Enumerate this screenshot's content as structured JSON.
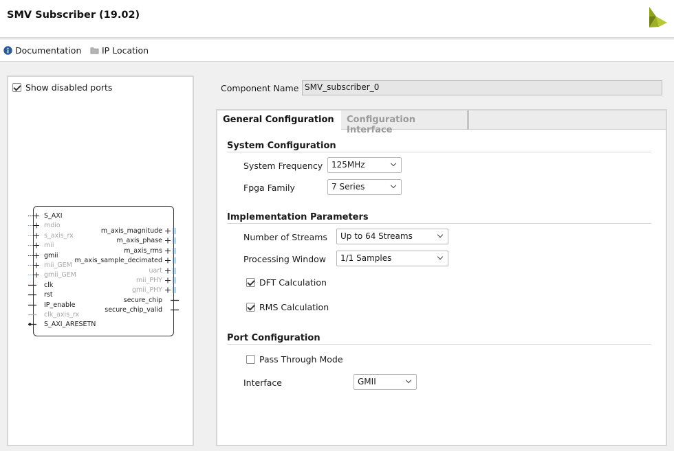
{
  "window": {
    "title": "SMV Subscriber (19.02)"
  },
  "toolbar": {
    "documentation": "Documentation",
    "ip_location": "IP Location"
  },
  "left_panel": {
    "show_disabled_ports": "Show disabled ports",
    "block": {
      "left_ports": [
        {
          "name": "S_AXI",
          "disabled": false
        },
        {
          "name": "mdio",
          "disabled": true
        },
        {
          "name": "s_axis_rx",
          "disabled": true
        },
        {
          "name": "mii",
          "disabled": true
        },
        {
          "name": "gmii",
          "disabled": false
        },
        {
          "name": "mii_GEM",
          "disabled": true
        },
        {
          "name": "gmii_GEM",
          "disabled": true
        },
        {
          "name": "clk",
          "disabled": false
        },
        {
          "name": "rst",
          "disabled": false
        },
        {
          "name": "IP_enable",
          "disabled": false
        },
        {
          "name": "clk_axis_rx",
          "disabled": true
        },
        {
          "name": "S_AXI_ARESETN",
          "disabled": false
        }
      ],
      "right_ports": [
        {
          "name": "m_axis_magnitude",
          "disabled": false
        },
        {
          "name": "m_axis_phase",
          "disabled": false
        },
        {
          "name": "m_axis_rms",
          "disabled": false
        },
        {
          "name": "m_axis_sample_decimated",
          "disabled": false
        },
        {
          "name": "uart",
          "disabled": true
        },
        {
          "name": "mii_PHY",
          "disabled": true
        },
        {
          "name": "gmii_PHY",
          "disabled": true
        },
        {
          "name": "secure_chip",
          "disabled": false
        },
        {
          "name": "secure_chip_valid",
          "disabled": false
        }
      ]
    }
  },
  "component": {
    "label": "Component Name",
    "value": "SMV_subscriber_0"
  },
  "tabs": [
    {
      "label": "General Configuration",
      "active": true
    },
    {
      "label": "Configuration Interface",
      "active": false
    }
  ],
  "system_configuration": {
    "title": "System Configuration",
    "frequency_label": "System Frequency",
    "frequency_value": "125MHz",
    "family_label": "Fpga Family",
    "family_value": "7 Series"
  },
  "implementation": {
    "title": "Implementation Parameters",
    "streams_label": "Number of Streams",
    "streams_value": "Up to 64 Streams",
    "window_label": "Processing Window",
    "window_value": "1/1 Samples",
    "dft_label": "DFT Calculation",
    "dft_checked": true,
    "rms_label": "RMS Calculation",
    "rms_checked": true
  },
  "port_configuration": {
    "title": "Port Configuration",
    "pass_through_label": "Pass Through Mode",
    "pass_through_checked": false,
    "interface_label": "Interface",
    "interface_value": "GMII"
  },
  "colors": {
    "logo_light": "#b9c832",
    "logo_dark": "#7a8a18",
    "info_blue": "#2a5b9a"
  },
  "icons": [
    "info-icon",
    "folder-icon",
    "xilinx-logo-icon",
    "chevron-down-icon"
  ]
}
